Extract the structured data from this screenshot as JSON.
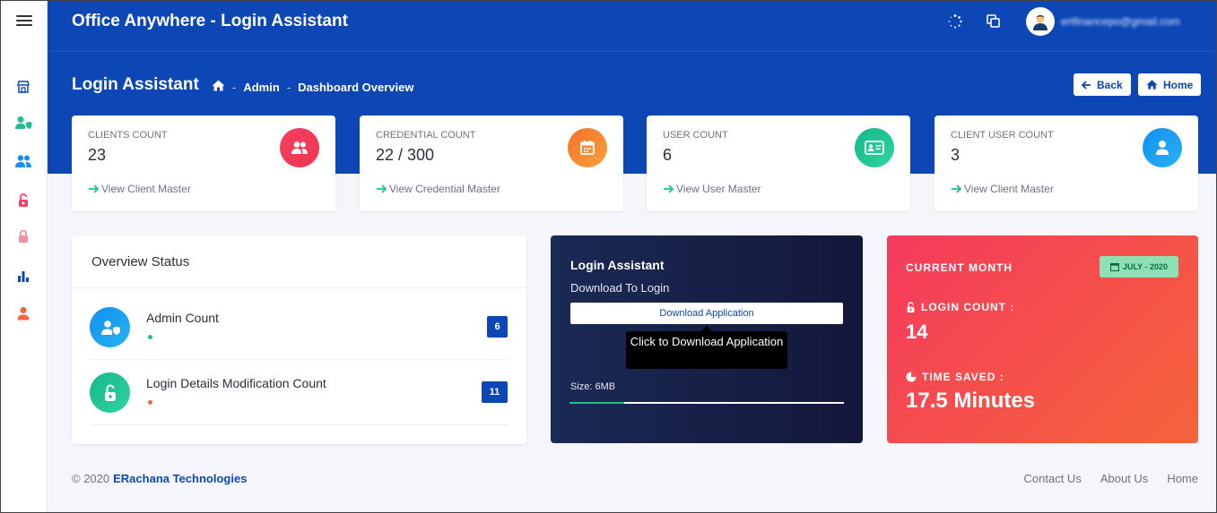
{
  "header": {
    "app_title": "Office Anywhere - Login Assistant",
    "user_email": "ertfinancepo@gmail.com",
    "icons": [
      "menu-icon",
      "spinner-icon",
      "window-icon",
      "user-avatar"
    ]
  },
  "page": {
    "title": "Login Assistant",
    "breadcrumb": [
      "Admin",
      "Dashboard Overview"
    ],
    "back_label": "Back",
    "home_label": "Home"
  },
  "sidebar": {
    "icons": [
      "store-icon",
      "user-shield-icon",
      "users-icon",
      "unlock-icon",
      "lock-icon",
      "bar-chart-icon",
      "user-icon"
    ]
  },
  "stats": [
    {
      "label": "CLIENTS COUNT",
      "value": "23",
      "link": "View Client Master",
      "icon": "users-icon",
      "color": "#f5405f"
    },
    {
      "label": "CREDENTIAL COUNT",
      "value": "22 / 300",
      "link": "View Credential Master",
      "icon": "calendar-icon",
      "color": "#f5642f"
    },
    {
      "label": "USER COUNT",
      "value": "6",
      "link": "View User Master",
      "icon": "id-card-icon",
      "color": "#1fc08e"
    },
    {
      "label": "CLIENT USER COUNT",
      "value": "3",
      "link": "View Client Master",
      "icon": "user-icon",
      "color": "#1a8ff0"
    }
  ],
  "overview": {
    "title": "Overview Status",
    "rows": [
      {
        "name": "Admin Count",
        "count": "6",
        "dot_color": "#1fc08e"
      },
      {
        "name": "Login Details Modification Count",
        "count": "11",
        "dot_color": "#f5643a"
      }
    ]
  },
  "download": {
    "title": "Login Assistant",
    "subtitle": "Download To Login",
    "button_label": "Download Application",
    "tooltip": "Click to Download Application",
    "size": "Size: 6MB",
    "progress": 0.2
  },
  "month": {
    "label": "CURRENT MONTH",
    "pill": "JULY - 2020",
    "login_count_label": "LOGIN COUNT :",
    "login_count": "14",
    "time_saved_label": "TIME SAVED :",
    "time_saved": "17.5 Minutes"
  },
  "footer": {
    "copyright": "© 2020",
    "company": "ERachana Technologies",
    "links": [
      "Contact Us",
      "About Us",
      "Home"
    ]
  }
}
